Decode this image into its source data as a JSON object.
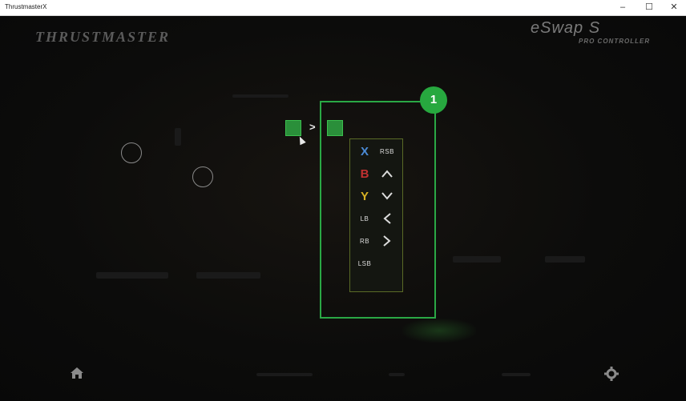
{
  "window": {
    "title": "ThrustmasterX",
    "controls": {
      "minimize": "–",
      "maximize": "☐",
      "close": "✕"
    }
  },
  "brand": {
    "logo_text": "THRUSTMASTER"
  },
  "product": {
    "name": "eSwap S",
    "subtitle": "PRO CONTROLLER"
  },
  "mapping": {
    "arrow": ">"
  },
  "callout": {
    "number": "1"
  },
  "picker": {
    "options": [
      {
        "label": "X",
        "color": "#4b8bd6",
        "icon": "x-button"
      },
      {
        "label": "RSB",
        "color": "#dcdcdc",
        "icon": "rsb-label"
      },
      {
        "label": "B",
        "color": "#c33131",
        "icon": "b-button"
      },
      {
        "label": "^",
        "color": "#dcdcdc",
        "icon": "dpad-up-icon"
      },
      {
        "label": "Y",
        "color": "#d8b224",
        "icon": "y-button"
      },
      {
        "label": "v",
        "color": "#dcdcdc",
        "icon": "dpad-down-icon"
      },
      {
        "label": "LB",
        "color": "#dcdcdc",
        "icon": "lb-label"
      },
      {
        "label": "<",
        "color": "#dcdcdc",
        "icon": "dpad-left-icon"
      },
      {
        "label": "RB",
        "color": "#dcdcdc",
        "icon": "rb-label"
      },
      {
        "label": ">",
        "color": "#dcdcdc",
        "icon": "dpad-right-icon"
      },
      {
        "label": "LSB",
        "color": "#dcdcdc",
        "icon": "lsb-label"
      }
    ]
  },
  "colors": {
    "accent": "#2aa845",
    "marker": "#27a83f",
    "picker_border": "#5a6a26"
  },
  "nav": {
    "home_icon": "home-icon",
    "settings_icon": "gear-icon"
  }
}
